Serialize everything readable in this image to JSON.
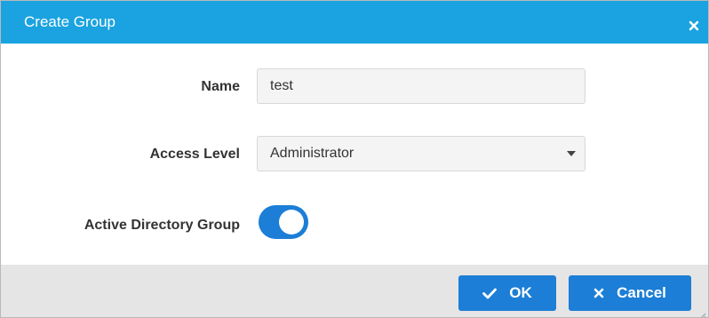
{
  "dialog": {
    "title": "Create Group",
    "close_icon": "close-icon"
  },
  "form": {
    "name_label": "Name",
    "name_value": "test",
    "access_label": "Access Level",
    "access_value": "Administrator",
    "ad_group_label": "Active Directory Group",
    "ad_group_enabled": true
  },
  "footer": {
    "ok_label": "OK",
    "ok_icon": "check-icon",
    "cancel_label": "Cancel",
    "cancel_icon": "close-icon"
  },
  "colors": {
    "header": "#1aa3e0",
    "button": "#1c7ed6",
    "footer": "#e5e5e5"
  }
}
